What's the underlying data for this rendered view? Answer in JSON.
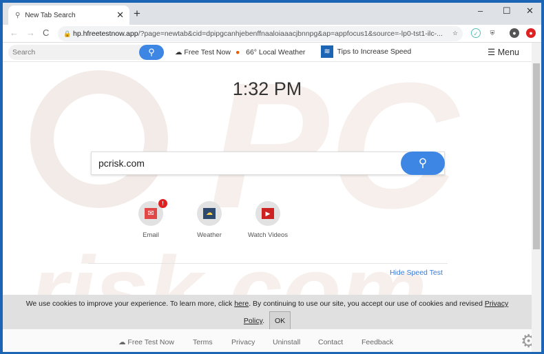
{
  "browser": {
    "tab_title": "New Tab Search",
    "url_host": "hp.hfreetestnow.app",
    "url_rest": "/?page=newtab&cid=dpipgcanhjebenffnaaloiaaacjbnnpg&ap=appfocus1&source=-lp0-tst1-ilc-..."
  },
  "toolbar": {
    "search_placeholder": "Search",
    "free_test": "Free Test Now",
    "weather": "66° Local Weather",
    "tips": "Tips to Increase Speed",
    "menu": "Menu"
  },
  "main": {
    "clock": "1:32 PM",
    "search_value": "pcrisk.com",
    "quick_links": [
      {
        "label": "Email",
        "badge": "!"
      },
      {
        "label": "Weather"
      },
      {
        "label": "Watch Videos"
      }
    ],
    "hide_speed_test": "Hide Speed Test"
  },
  "cookie": {
    "text1": "We use cookies to improve your experience. To learn more, click ",
    "here": "here",
    "text2": ". By continuing to use our site, you accept our use of cookies and revised ",
    "privacy": "Privacy",
    "policy": "Policy",
    "dot": ".",
    "ok": "OK"
  },
  "footer": {
    "links": [
      "Free Test Now",
      "Terms",
      "Privacy",
      "Uninstall",
      "Contact",
      "Feedback"
    ]
  },
  "colors": {
    "accent": "#3d86e4",
    "frame": "#1c64b4"
  }
}
